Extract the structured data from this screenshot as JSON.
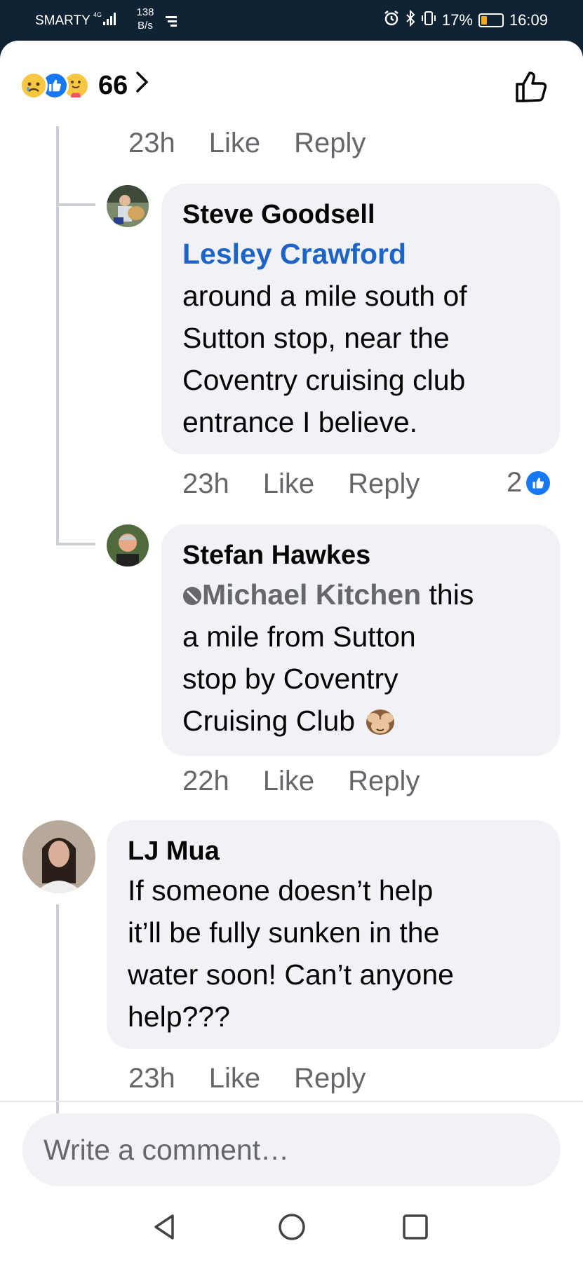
{
  "status_bar": {
    "carrier": "SMARTY",
    "network": "4G",
    "speed_value": "138",
    "speed_unit": "B/s",
    "battery": "17%",
    "time": "16:09"
  },
  "reactions": {
    "count": "66",
    "types": [
      "sad",
      "like",
      "care"
    ]
  },
  "comments": [
    {
      "id": "prev",
      "time": "23h",
      "like": "Like",
      "reply": "Reply"
    },
    {
      "id": "steve",
      "author": "Steve Goodsell",
      "mention": "Lesley Crawford",
      "text_lines": [
        "around a mile south of",
        "Sutton stop, near the",
        "Coventry cruising club",
        "entrance I believe."
      ],
      "time": "23h",
      "like": "Like",
      "reply": "Reply",
      "like_count": "2"
    },
    {
      "id": "stefan",
      "author": "Stefan Hawkes",
      "mention": "Michael Kitchen",
      "text_first": " this",
      "text_lines": [
        "a mile from Sutton",
        "stop by Coventry",
        "Cruising Club"
      ],
      "emoji": "🙈",
      "time": "22h",
      "like": "Like",
      "reply": "Reply"
    },
    {
      "id": "lj",
      "author": "LJ Mua",
      "text_lines": [
        "If someone doesn’t help",
        "it’ll be fully sunken in the",
        "water soon! Can’t anyone",
        "help???"
      ],
      "time": "23h",
      "like": "Like",
      "reply": "Reply"
    }
  ],
  "composer": {
    "placeholder": "Write a comment…"
  },
  "colors": {
    "accent": "#1877f2",
    "mention": "#1c64c8",
    "bubble": "#f0f2f5",
    "meta": "#65676b"
  }
}
